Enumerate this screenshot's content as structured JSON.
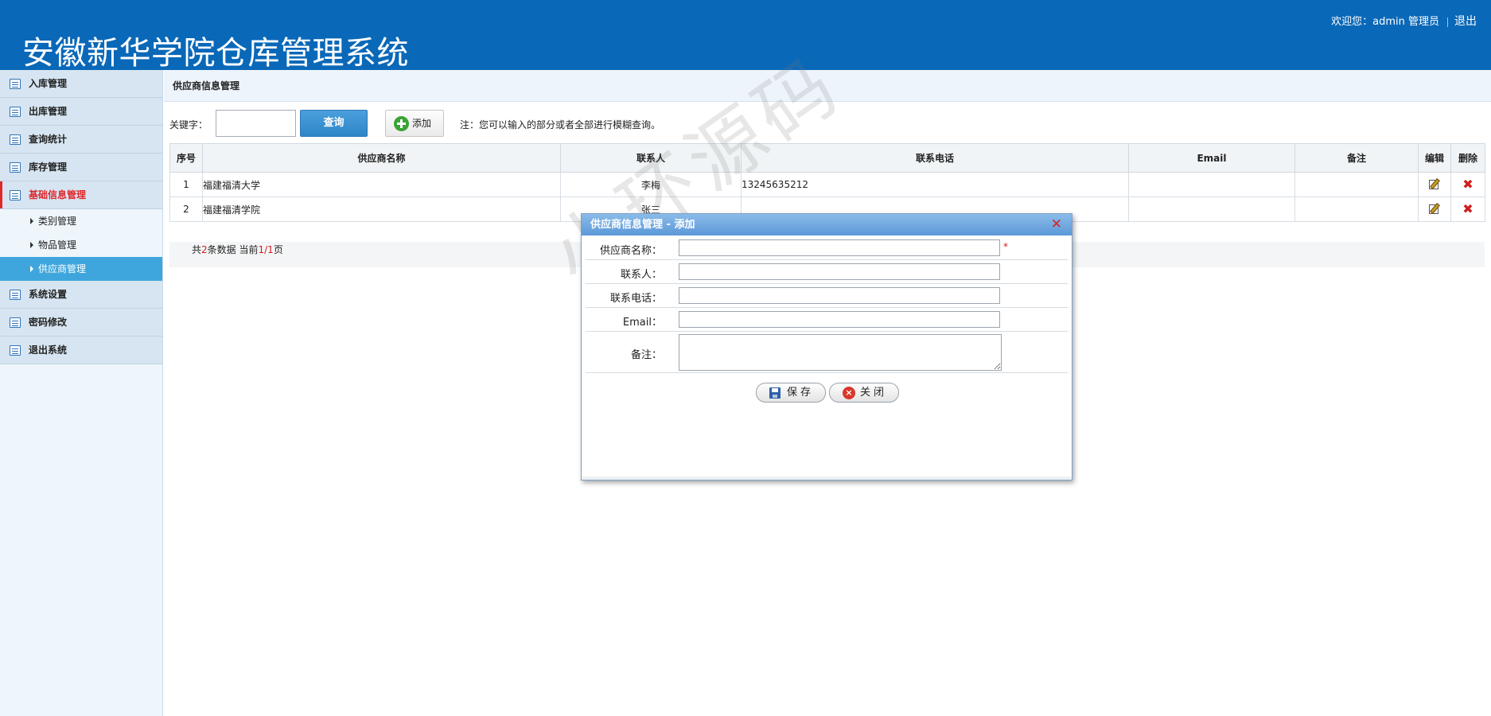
{
  "header": {
    "title": "安徽新华学院仓库管理系统",
    "welcome": "欢迎您：admin 管理员",
    "logout": "退出"
  },
  "sidebar": {
    "items": [
      {
        "label": "入库管理"
      },
      {
        "label": "出库管理"
      },
      {
        "label": "查询统计"
      },
      {
        "label": "库存管理"
      },
      {
        "label": "基础信息管理"
      },
      {
        "label": "系统设置"
      },
      {
        "label": "密码修改"
      },
      {
        "label": "退出系统"
      }
    ],
    "subitems": [
      {
        "label": "类别管理"
      },
      {
        "label": "物品管理"
      },
      {
        "label": "供应商管理"
      }
    ]
  },
  "main": {
    "page_title": "供应商信息管理",
    "search": {
      "label": "关键字：",
      "value": "",
      "query_label": "查询",
      "add_label": "添加",
      "note": "注：您可以输入的部分或者全部进行模糊查询。"
    },
    "table": {
      "headers": [
        "序号",
        "供应商名称",
        "联系人",
        "联系电话",
        "Email",
        "备注",
        "编辑",
        "删除"
      ],
      "rows": [
        {
          "no": "1",
          "name": "福建福清大学",
          "contact": "李梅",
          "phone": "13245635212",
          "email": "",
          "remark": ""
        },
        {
          "no": "2",
          "name": "福建福清学院",
          "contact": "张三",
          "phone": "",
          "email": "",
          "remark": ""
        }
      ]
    },
    "pager": {
      "prefix": "共",
      "count": "2",
      "mid": "条数据 当前",
      "current": "1",
      "slash": "/",
      "total": "1",
      "suffix": "页"
    }
  },
  "watermark": "小环源码",
  "dialog": {
    "title": "供应商信息管理 - 添加",
    "close_glyph": "✕",
    "fields": [
      {
        "label": "供应商名称：",
        "value": ""
      },
      {
        "label": "联系人：",
        "value": ""
      },
      {
        "label": "联系电话：",
        "value": ""
      },
      {
        "label": "Email：",
        "value": ""
      },
      {
        "label": "备注：",
        "value": ""
      }
    ],
    "required_mark": "*",
    "save_label": "保存",
    "close_label": "关闭"
  },
  "colors": {
    "header_bg": "#0a68b8",
    "active_nav": "#e0282c",
    "active_sub_bg": "#3ea6dd",
    "query_btn": "#2f86c8"
  }
}
